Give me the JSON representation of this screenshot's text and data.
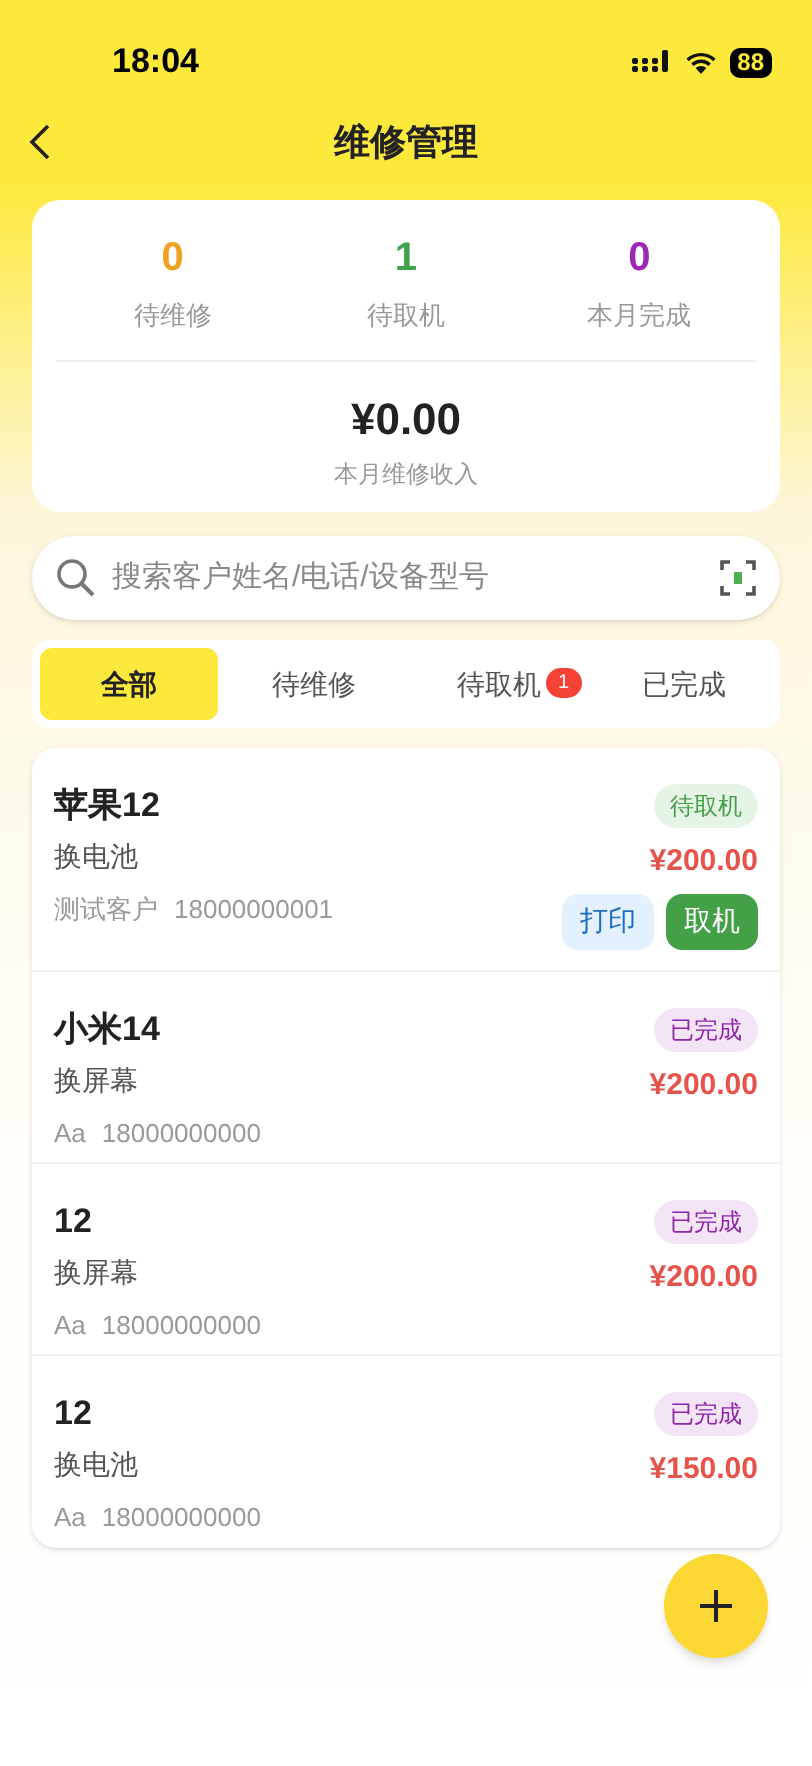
{
  "status_bar": {
    "time": "18:04",
    "battery": "88"
  },
  "header": {
    "title": "维修管理"
  },
  "stats": [
    {
      "value": "0",
      "label": "待维修",
      "color": "#f0a020"
    },
    {
      "value": "1",
      "label": "待取机",
      "color": "#3fa34d"
    },
    {
      "value": "0",
      "label": "本月完成",
      "color": "#9c27b0"
    }
  ],
  "income": {
    "value": "¥0.00",
    "label": "本月维修收入"
  },
  "search": {
    "placeholder": "搜索客户姓名/电话/设备型号"
  },
  "tabs": [
    {
      "label": "全部",
      "selected": true
    },
    {
      "label": "待维修",
      "selected": false
    },
    {
      "label": "待取机",
      "selected": false,
      "badge": "1"
    },
    {
      "label": "已完成",
      "selected": false
    }
  ],
  "orders": [
    {
      "device": "苹果12",
      "service": "换电池",
      "customer": "测试客户",
      "phone": "18000000001",
      "status": {
        "label": "待取机",
        "kind": "pickup"
      },
      "price": "¥200.00",
      "actions": [
        {
          "label": "打印",
          "kind": "secondary"
        },
        {
          "label": "取机",
          "kind": "primary"
        }
      ]
    },
    {
      "device": "小米14",
      "service": "换屏幕",
      "customer": "Aa",
      "phone": "18000000000",
      "status": {
        "label": "已完成",
        "kind": "done"
      },
      "price": "¥200.00"
    },
    {
      "device": "12",
      "service": "换屏幕",
      "customer": "Aa",
      "phone": "18000000000",
      "status": {
        "label": "已完成",
        "kind": "done"
      },
      "price": "¥200.00"
    },
    {
      "device": "12",
      "service": "换电池",
      "customer": "Aa",
      "phone": "18000000000",
      "status": {
        "label": "已完成",
        "kind": "done"
      },
      "price": "¥150.00"
    }
  ]
}
